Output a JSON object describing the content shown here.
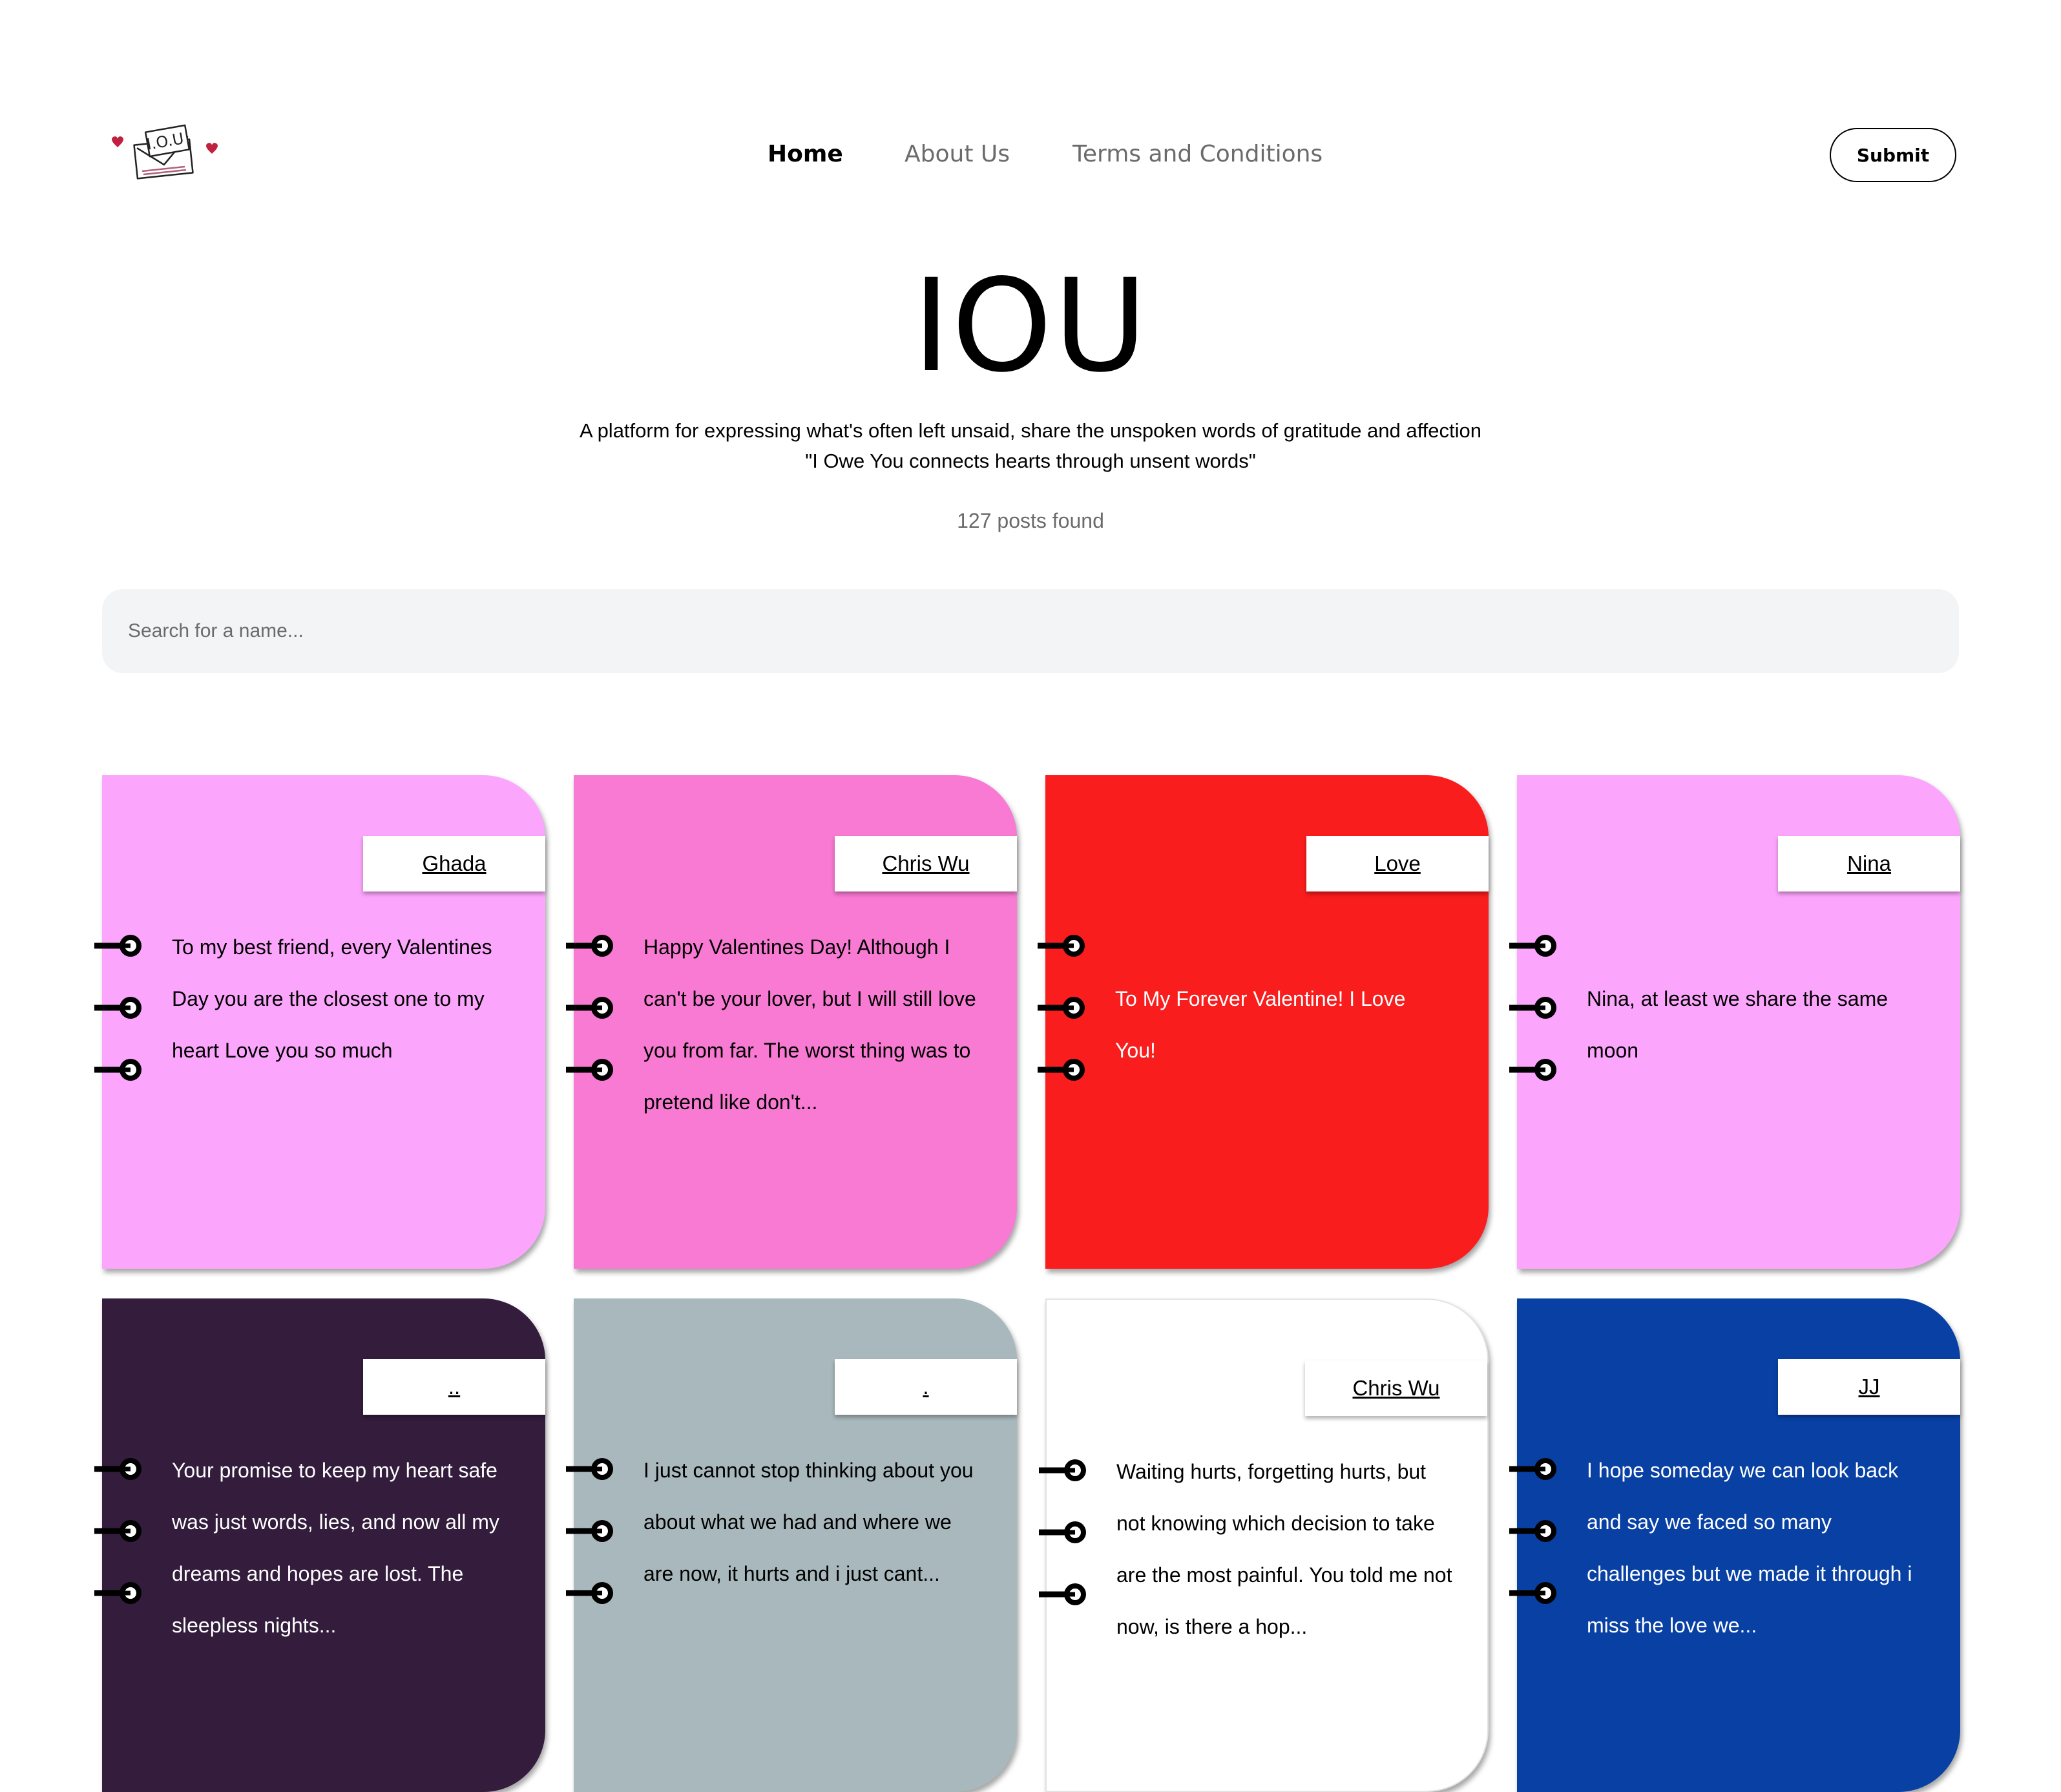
{
  "header": {
    "logo_text": "I.O.U",
    "nav": [
      {
        "label": "Home",
        "active": true
      },
      {
        "label": "About Us",
        "active": false
      },
      {
        "label": "Terms and Conditions",
        "active": false
      }
    ],
    "submit_label": "Submit"
  },
  "hero": {
    "title": "IOU",
    "tagline_line1": "A platform for expressing what's often left unsaid, share the unspoken words of gratitude and affection",
    "tagline_line2": "\"I Owe You connects hearts through unsent words\"",
    "posts_count": "127 posts found"
  },
  "search": {
    "placeholder": "Search for a name...",
    "value": ""
  },
  "cards": [
    {
      "name": "Ghada",
      "bg": "#fca5fc",
      "text_color": "#000000",
      "message": "To my best friend, every Valentines Day you are the closest one to my heart Love you so much"
    },
    {
      "name": "Chris Wu",
      "bg": "#f87ad3",
      "text_color": "#000000",
      "message": "Happy Valentines Day! Although I can't be your lover, but I will still love you from far. The worst thing was to pretend like don't..."
    },
    {
      "name": "Love",
      "bg": "#f91d1d",
      "text_color": "#ffffff",
      "message": "To My Forever Valentine! I Love You!"
    },
    {
      "name": "Nina",
      "bg": "#fca5fc",
      "text_color": "#000000",
      "message": "Nina, at least we share the same moon"
    },
    {
      "name": "..",
      "bg": "#331c3c",
      "text_color": "#ffffff",
      "message": "Your promise to keep my heart safe was just words, lies, and now all my dreams and hopes are lost. The sleepless nights..."
    },
    {
      "name": ".",
      "bg": "#a8b8bc",
      "text_color": "#000000",
      "message": "I just cannot stop thinking about you about what we had and where we are now, it hurts and i just cant..."
    },
    {
      "name": "Chris Wu",
      "bg": "#ffffff",
      "text_color": "#000000",
      "message": "Waiting hurts, forgetting hurts, but not knowing which decision to take are the most painful. You told me not now, is there a hop..."
    },
    {
      "name": "JJ",
      "bg": "#0840a4",
      "text_color": "#ffffff",
      "message": "I hope someday we can look back and say we faced so many challenges but we made it through i miss the love we..."
    }
  ]
}
